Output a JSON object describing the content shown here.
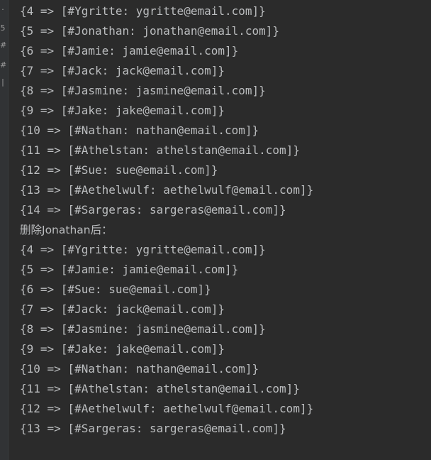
{
  "gutter": {
    "marks": [
      "·",
      "5",
      "#",
      "#",
      "|"
    ]
  },
  "output": {
    "before": [
      "{4 => [#Ygritte: ygritte@email.com]}",
      "{5 => [#Jonathan: jonathan@email.com]}",
      "{6 => [#Jamie: jamie@email.com]}",
      "{7 => [#Jack: jack@email.com]}",
      "{8 => [#Jasmine: jasmine@email.com]}",
      "{9 => [#Jake: jake@email.com]}",
      "{10 => [#Nathan: nathan@email.com]}",
      "{11 => [#Athelstan: athelstan@email.com]}",
      "{12 => [#Sue: sue@email.com]}",
      "{13 => [#Aethelwulf: aethelwulf@email.com]}",
      "{14 => [#Sargeras: sargeras@email.com]}"
    ],
    "header": "删除Jonathan后：",
    "after": [
      "{4 => [#Ygritte: ygritte@email.com]}",
      "{5 => [#Jamie: jamie@email.com]}",
      "{6 => [#Sue: sue@email.com]}",
      "{7 => [#Jack: jack@email.com]}",
      "{8 => [#Jasmine: jasmine@email.com]}",
      "{9 => [#Jake: jake@email.com]}",
      "{10 => [#Nathan: nathan@email.com]}",
      "{11 => [#Athelstan: athelstan@email.com]}",
      "{12 => [#Aethelwulf: aethelwulf@email.com]}",
      "{13 => [#Sargeras: sargeras@email.com]}"
    ]
  }
}
